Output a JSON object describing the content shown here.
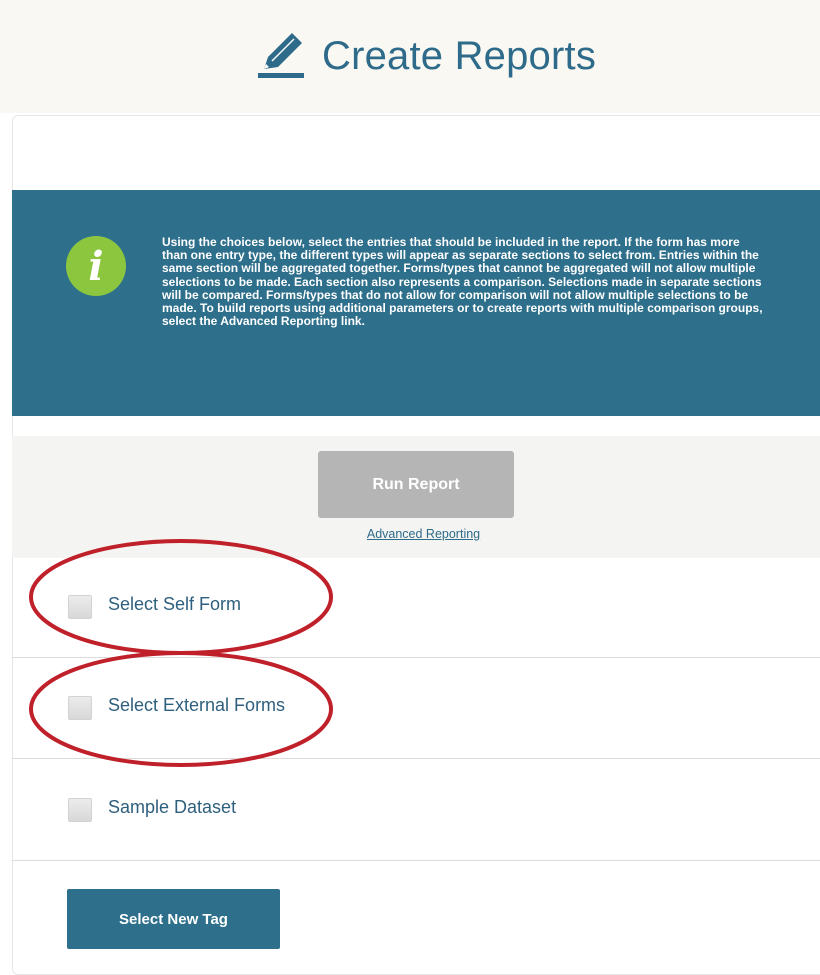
{
  "header": {
    "title": "Create Reports",
    "icon": "pencil-icon"
  },
  "info": {
    "icon": "info-icon",
    "icon_glyph": "i",
    "text": "Using the choices below, select the entries that should be included in the report. If the form has more than one entry type, the different types will appear as separate sections to select from. Entries within the same section will be aggregated together. Forms/types that cannot be aggregated will not allow multiple selections to be made. Each section also represents a comparison. Selections made in separate sections will be compared. Forms/types that do not allow for comparison will not allow multiple selections to be made. To build reports using additional parameters or to create reports with multiple comparison groups, select the Advanced Reporting link."
  },
  "actions": {
    "run_label": "Run Report",
    "run_enabled": false,
    "advanced_link": "Advanced Reporting"
  },
  "sections": [
    {
      "label": "Select Self Form",
      "checked": false,
      "highlighted": true
    },
    {
      "label": "Select External Forms",
      "checked": false,
      "highlighted": true
    },
    {
      "label": "Sample Dataset",
      "checked": false,
      "highlighted": false
    }
  ],
  "footer": {
    "tag_button_label": "Select New Tag"
  },
  "colors": {
    "brand_blue": "#2e6f8c",
    "title_blue": "#2e6b8a",
    "info_green": "#8cc63f",
    "disabled_gray": "#b5b5b5",
    "annotation_red": "#c0202a",
    "header_bg": "#faf8f2"
  }
}
